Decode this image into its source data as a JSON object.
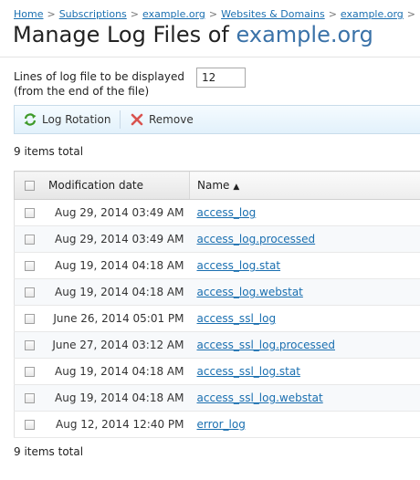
{
  "breadcrumb": {
    "items": [
      "Home",
      "Subscriptions",
      "example.org",
      "Websites & Domains",
      "example.org"
    ],
    "separator": ">"
  },
  "title": {
    "prefix": "Manage Log Files of",
    "domain": "example.org"
  },
  "lines_setting": {
    "label_line1": "Lines of log file to be displayed",
    "label_line2": "(from the end of the file)",
    "value": "12"
  },
  "toolbar": {
    "log_rotation_label": "Log Rotation",
    "log_rotation_icon": "rotate-icon",
    "remove_label": "Remove",
    "remove_icon": "remove-x-icon"
  },
  "items_total": "9 items total",
  "table": {
    "columns": {
      "date": "Modification date",
      "name": "Name",
      "sort_indicator": "▲"
    },
    "rows": [
      {
        "date": "Aug 29, 2014 03:49 AM",
        "name": "access_log"
      },
      {
        "date": "Aug 29, 2014 03:49 AM",
        "name": "access_log.processed"
      },
      {
        "date": "Aug 19, 2014 04:18 AM",
        "name": "access_log.stat"
      },
      {
        "date": "Aug 19, 2014 04:18 AM",
        "name": "access_log.webstat"
      },
      {
        "date": "June 26, 2014 05:01 PM",
        "name": "access_ssl_log"
      },
      {
        "date": "June 27, 2014 03:12 AM",
        "name": "access_ssl_log.processed"
      },
      {
        "date": "Aug 19, 2014 04:18 AM",
        "name": "access_ssl_log.stat"
      },
      {
        "date": "Aug 19, 2014 04:18 AM",
        "name": "access_ssl_log.webstat"
      },
      {
        "date": "Aug 12, 2014 12:40 PM",
        "name": "error_log"
      }
    ]
  },
  "colors": {
    "link": "#1a6fb0",
    "title_domain": "#3a72a8",
    "toolbar_bg": "#e2f1fb"
  }
}
